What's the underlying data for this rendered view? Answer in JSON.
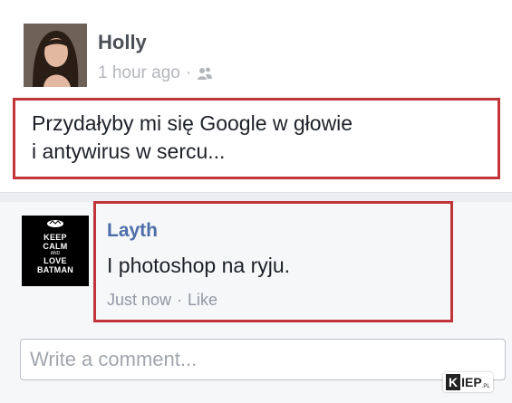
{
  "post": {
    "author": "Holly",
    "time": "1 hour ago",
    "separator": "·",
    "audience_icon": "friends-icon",
    "text": "Przydałyby mi się Google w głowie\ni antywirus w sercu..."
  },
  "comment": {
    "author": "Layth",
    "text": "I photoshop na ryju.",
    "time": "Just now",
    "separator": "·",
    "like_label": "Like",
    "avatar_lines": [
      "KEEP",
      "CALM",
      "AND",
      "LOVE",
      "BATMAN"
    ]
  },
  "composer": {
    "placeholder": "Write a comment..."
  },
  "watermark": {
    "logo": "KIEP.pl"
  },
  "colors": {
    "highlight_border": "#c1343a",
    "link_blue": "#4c6ea8",
    "muted_text": "#9197a3"
  }
}
